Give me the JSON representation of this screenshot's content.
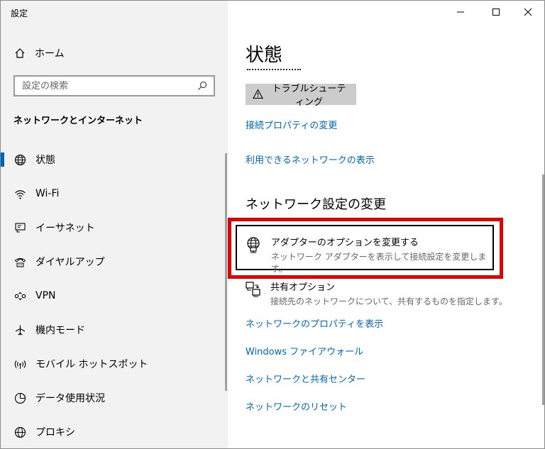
{
  "app": {
    "title": "設定"
  },
  "window_controls": {
    "minimize": "—",
    "maximize": "□",
    "close": "✕"
  },
  "sidebar": {
    "home_label": "ホーム",
    "search_placeholder": "設定の検索",
    "section_title": "ネットワークとインターネット",
    "items": [
      {
        "label": "状態",
        "icon": "globe-icon",
        "active": true
      },
      {
        "label": "Wi-Fi",
        "icon": "wifi-icon"
      },
      {
        "label": "イーサネット",
        "icon": "ethernet-icon"
      },
      {
        "label": "ダイヤルアップ",
        "icon": "dialup-icon"
      },
      {
        "label": "VPN",
        "icon": "vpn-icon"
      },
      {
        "label": "機内モード",
        "icon": "airplane-icon"
      },
      {
        "label": "モバイル ホットスポット",
        "icon": "hotspot-icon"
      },
      {
        "label": "データ使用状況",
        "icon": "data-usage-icon"
      },
      {
        "label": "プロキシ",
        "icon": "globe-icon"
      }
    ]
  },
  "main": {
    "title": "状態",
    "troubleshoot_label": "トラブルシューティング",
    "links_top": [
      "接続プロパティの変更",
      "利用できるネットワークの表示"
    ],
    "section_heading": "ネットワーク設定の変更",
    "adapter_option": {
      "title": "アダプターのオプションを変更する",
      "desc": "ネットワーク アダプターを表示して接続設定を変更します。"
    },
    "sharing_option": {
      "title": "共有オプション",
      "desc": "接続先のネットワークについて、共有するものを指定します。"
    },
    "links_bottom": [
      "ネットワークのプロパティを表示",
      "Windows ファイアウォール",
      "ネットワークと共有センター",
      "ネットワークのリセット"
    ]
  },
  "colors": {
    "accent": "#0067c0",
    "highlight": "#e00000",
    "sidebar_bg": "#f2f2f2"
  }
}
